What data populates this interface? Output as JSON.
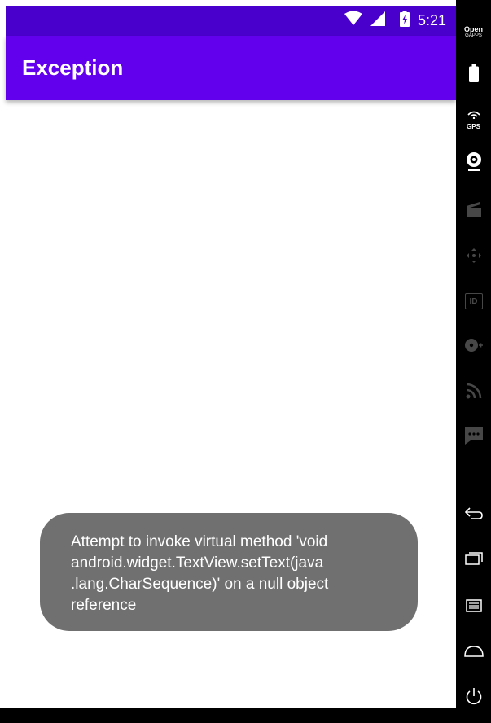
{
  "status_bar": {
    "time": "5:21",
    "wifi_icon": "wifi-icon",
    "signal_icon": "signal-icon",
    "battery_icon": "battery-charging-icon"
  },
  "app_bar": {
    "title": "Exception"
  },
  "toast": {
    "lines": [
      "Attempt to invoke virtual method 'void",
      "android.widget.TextView.setText(java",
      ".lang.CharSequence)' on a null object",
      "reference"
    ]
  },
  "side_toolbar": {
    "open_gapps_line1": "Open",
    "open_gapps_line2": "GAPPS",
    "gps_label": "GPS",
    "id_label": "ID"
  },
  "colors": {
    "status_bar": "#4a00cd",
    "app_bar": "#6200ee",
    "toast_bg": "#707070",
    "toolbar_bg": "#000000"
  }
}
